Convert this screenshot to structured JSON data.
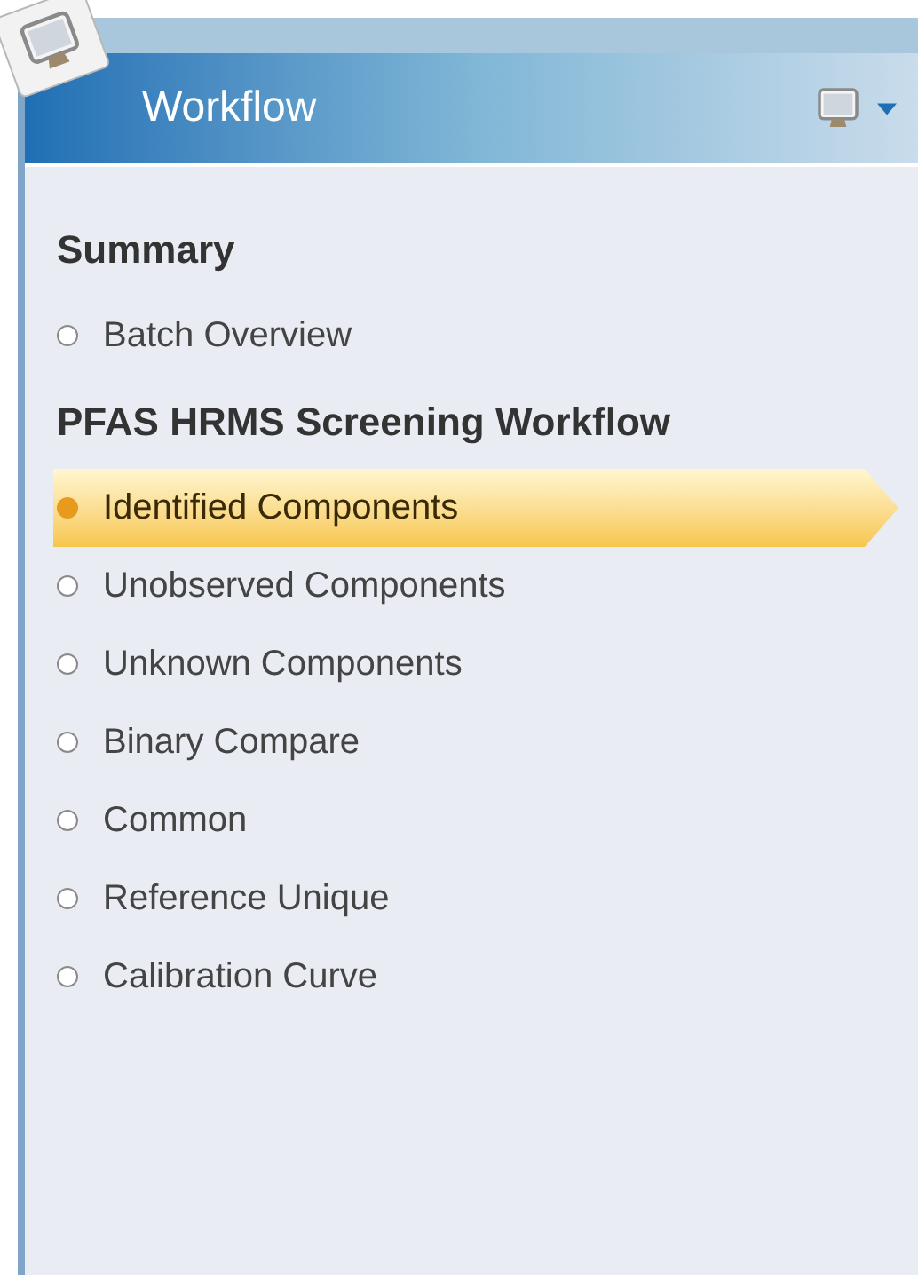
{
  "panel": {
    "title": "Workflow"
  },
  "sections": [
    {
      "title": "Summary",
      "items": [
        {
          "label": "Batch Overview",
          "selected": false
        }
      ]
    },
    {
      "title": "PFAS HRMS Screening Workflow",
      "items": [
        {
          "label": "Identified Components",
          "selected": true
        },
        {
          "label": "Unobserved Components",
          "selected": false
        },
        {
          "label": "Unknown Components",
          "selected": false
        },
        {
          "label": "Binary Compare",
          "selected": false
        },
        {
          "label": "Common",
          "selected": false
        },
        {
          "label": "Reference Unique",
          "selected": false
        },
        {
          "label": "Calibration Curve",
          "selected": false
        }
      ]
    }
  ]
}
